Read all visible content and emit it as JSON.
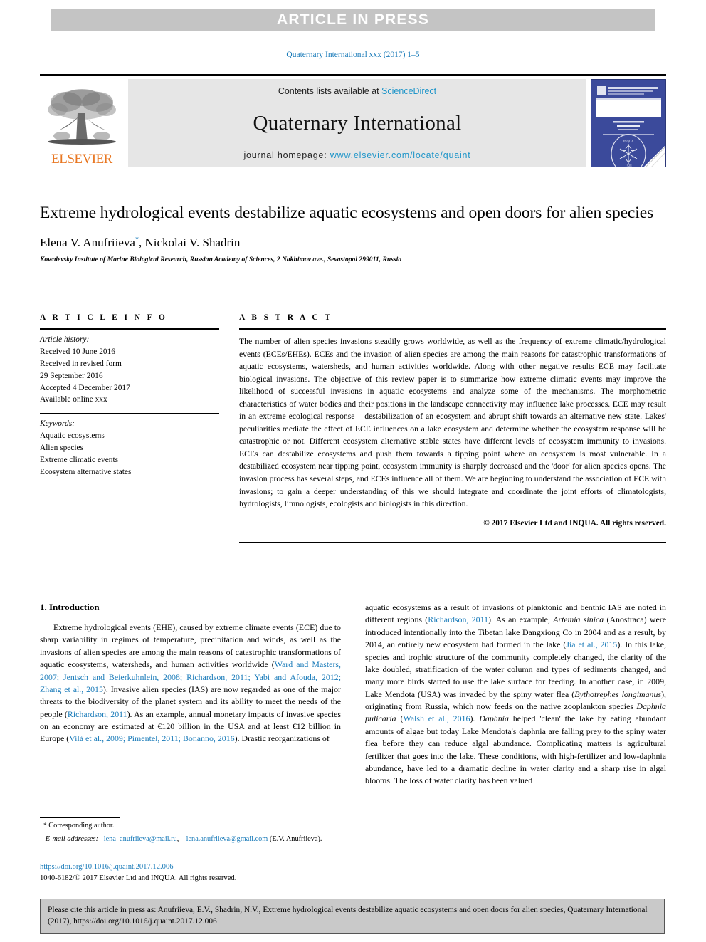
{
  "banner": {
    "text": "ARTICLE IN PRESS",
    "bg_color": "#c4c4c4",
    "text_color": "#ffffff"
  },
  "running_head": {
    "text": "Quaternary International xxx (2017) 1–5",
    "color": "#1a7bb9"
  },
  "masthead": {
    "publisher_logo_label": "ELSEVIER",
    "publisher_logo_color": "#e87722",
    "contents_prefix": "Contents lists available at ",
    "contents_link": "ScienceDirect",
    "journal_name": "Quaternary International",
    "homepage_prefix": "journal homepage: ",
    "homepage_url": "www.elsevier.com/locate/quaint",
    "link_color": "#2196c9",
    "panel_bg": "#e6e6e6",
    "cover_bg": "#3b4a9b"
  },
  "article": {
    "title": "Extreme hydrological events destabilize aquatic ecosystems and open doors for alien species",
    "authors": "Elena V. Anufriieva",
    "authors_rest": ", Nickolai V. Shadrin",
    "corresponding_marker": "*",
    "affiliation": "Kowalevsky Institute of Marine Biological Research, Russian Academy of Sciences, 2 Nakhimov ave., Sevastopol 299011, Russia"
  },
  "article_info": {
    "heading": "A R T I C L E   I N F O",
    "history_label": "Article history:",
    "history": [
      "Received 10 June 2016",
      "Received in revised form",
      "29 September 2016",
      "Accepted 4 December 2017",
      "Available online xxx"
    ],
    "keywords_label": "Keywords:",
    "keywords": [
      "Aquatic ecosystems",
      "Alien species",
      "Extreme climatic events",
      "Ecosystem alternative states"
    ]
  },
  "abstract": {
    "heading": "A B S T R A C T",
    "text": "The number of alien species invasions steadily grows worldwide, as well as the frequency of extreme climatic/hydrological events (ECEs/EHEs). ECEs and the invasion of alien species are among the main reasons for catastrophic transformations of aquatic ecosystems, watersheds, and human activities worldwide. Along with other negative results ECE may facilitate biological invasions. The objective of this review paper is to summarize how extreme climatic events may improve the likelihood of successful invasions in aquatic ecosystems and analyze some of the mechanisms. The morphometric characteristics of water bodies and their positions in the landscape connectivity may influence lake processes. ECE may result in an extreme ecological response – destabilization of an ecosystem and abrupt shift towards an alternative new state. Lakes' peculiarities mediate the effect of ECE influences on a lake ecosystem and determine whether the ecosystem response will be catastrophic or not. Different ecosystem alternative stable states have different levels of ecosystem immunity to invasions. ECEs can destabilize ecosystems and push them towards a tipping point where an ecosystem is most vulnerable. In a destabilized ecosystem near tipping point, ecosystem immunity is sharply decreased and the 'door' for alien species opens. The invasion process has several steps, and ECEs influence all of them. We are beginning to understand the association of ECE with invasions; to gain a deeper understanding of this we should integrate and coordinate the joint efforts of climatologists, hydrologists, limnologists, ecologists and biologists in this direction.",
    "copyright": "© 2017 Elsevier Ltd and INQUA. All rights reserved."
  },
  "body": {
    "section_number": "1.",
    "section_title": "Introduction",
    "left_paragraph_parts": [
      {
        "t": "Extreme hydrological events (EHE), caused by extreme climate events (ECE) due to sharp variability in regimes of temperature, precipitation and winds, as well as the invasions of alien species are among the main reasons of catastrophic transformations of aquatic ecosystems, watersheds, and human activities worldwide (",
        "k": "plain"
      },
      {
        "t": "Ward and Masters, 2007; Jentsch and Beierkuhnlein, 2008; Richardson, 2011; Yabi and Afouda, 2012; Zhang et al., 2015",
        "k": "ref"
      },
      {
        "t": "). Invasive alien species (IAS) are now regarded as one of the major threats to the biodiversity of the planet system and its ability to meet the needs of the people (",
        "k": "plain"
      },
      {
        "t": "Richardson, 2011",
        "k": "ref"
      },
      {
        "t": "). As an example, annual monetary impacts of invasive species on an economy are estimated at €120 billion in the USA and at least €12 billion in Europe (",
        "k": "plain"
      },
      {
        "t": "Vilà et al., 2009; Pimentel, 2011; Bonanno, 2016",
        "k": "ref"
      },
      {
        "t": "). Drastic reorganizations of",
        "k": "plain"
      }
    ],
    "right_paragraph_parts": [
      {
        "t": "aquatic ecosystems as a result of invasions of planktonic and benthic IAS are noted in different regions (",
        "k": "plain"
      },
      {
        "t": "Richardson, 2011",
        "k": "ref"
      },
      {
        "t": "). As an example, ",
        "k": "plain"
      },
      {
        "t": "Artemia sinica",
        "k": "ital"
      },
      {
        "t": " (Anostraca) were introduced intentionally into the Tibetan lake Dangxiong Co in 2004 and as a result, by 2014, an entirely new ecosystem had formed in the lake (",
        "k": "plain"
      },
      {
        "t": "Jia et al., 2015",
        "k": "ref"
      },
      {
        "t": "). In this lake, species and trophic structure of the community completely changed, the clarity of the lake doubled, stratification of the water column and types of sediments changed, and many more birds started to use the lake surface for feeding. In another case, in 2009, Lake Mendota (USA) was invaded by the spiny water flea (",
        "k": "plain"
      },
      {
        "t": "Bythotrephes longimanus",
        "k": "ital"
      },
      {
        "t": "), originating from Russia, which now feeds on the native zooplankton species ",
        "k": "plain"
      },
      {
        "t": "Daphnia pulicaria",
        "k": "ital"
      },
      {
        "t": " (",
        "k": "plain"
      },
      {
        "t": "Walsh et al., 2016",
        "k": "ref"
      },
      {
        "t": "). ",
        "k": "plain"
      },
      {
        "t": "Daphnia",
        "k": "ital"
      },
      {
        "t": " helped 'clean' the lake by eating abundant amounts of algae but today Lake Mendota's daphnia are falling prey to the spiny water flea before they can reduce algal abundance. Complicating matters is agricultural fertilizer that goes into the lake. These conditions, with high-fertilizer and low-daphnia abundance, have led to a dramatic decline in water clarity and a sharp rise in algal blooms. The loss of water clarity has been valued",
        "k": "plain"
      }
    ]
  },
  "footnote": {
    "star": "*",
    "corresponding": "Corresponding author.",
    "email_label": "E-mail addresses:",
    "email_1": "lena_anufriieva@mail.ru",
    "email_sep": ", ",
    "email_2": "lena.anufriieva@gmail.com",
    "email_owner": "(E.V. Anufriieva)."
  },
  "doi": {
    "link": "https://doi.org/10.1016/j.quaint.2017.12.006",
    "issn_line": "1040-6182/© 2017 Elsevier Ltd and INQUA. All rights reserved."
  },
  "cite_box": {
    "text": "Please cite this article in press as: Anufriieva, E.V., Shadrin, N.V., Extreme hydrological events destabilize aquatic ecosystems and open doors for alien species, Quaternary International (2017), https://doi.org/10.1016/j.quaint.2017.12.006",
    "bg_color": "#c9c9c9"
  }
}
